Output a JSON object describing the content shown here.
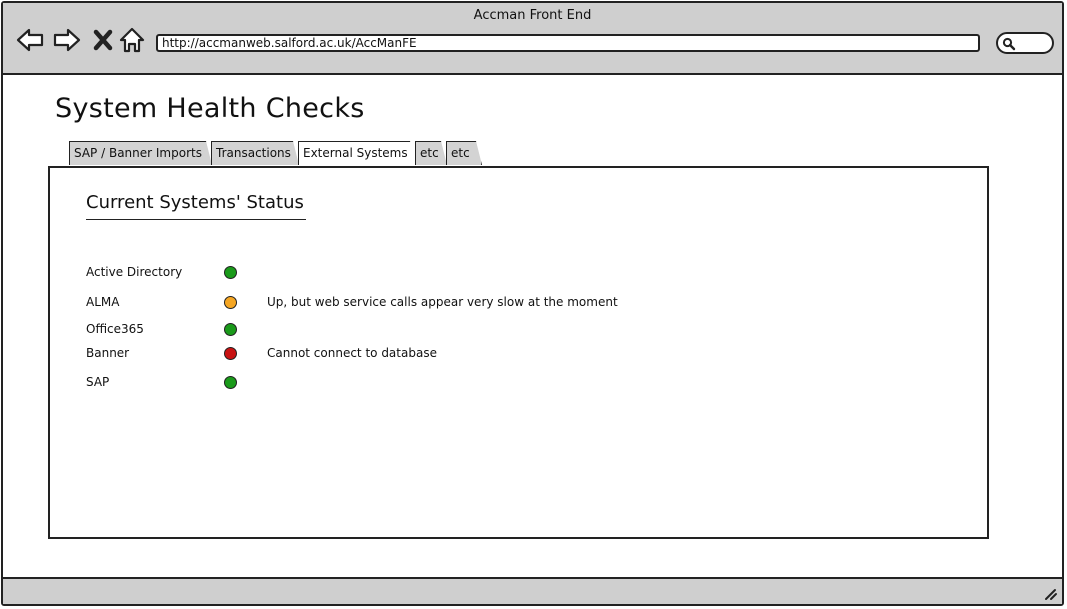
{
  "window": {
    "title": "Accman Front End"
  },
  "nav": {
    "back_icon": "arrow-left-icon",
    "forward_icon": "arrow-right-icon",
    "stop_icon": "close-x-icon",
    "home_icon": "home-icon"
  },
  "address": {
    "url": "http://accmanweb.salford.ac.uk/AccManFE"
  },
  "search": {
    "icon": "search-icon"
  },
  "page": {
    "title": "System Health Checks"
  },
  "tabs": [
    {
      "label": "SAP / Banner Imports"
    },
    {
      "label": "Transactions"
    },
    {
      "label": "External Systems"
    },
    {
      "label": "etc"
    },
    {
      "label": "etc"
    }
  ],
  "panel": {
    "section_title": "Current Systems' Status",
    "systems": [
      {
        "name": "Active Directory",
        "status": "green",
        "message": ""
      },
      {
        "name": "ALMA",
        "status": "amber",
        "message": "Up, but web service calls appear very slow at the moment"
      },
      {
        "name": "Office365",
        "status": "green",
        "message": ""
      },
      {
        "name": "Banner",
        "status": "red",
        "message": "Cannot connect to database"
      },
      {
        "name": "SAP",
        "status": "green",
        "message": ""
      }
    ]
  },
  "colors": {
    "green": "#1a9a1a",
    "amber": "#f5a623",
    "red": "#c81212",
    "chrome": "#cfcfcf",
    "border": "#222222"
  }
}
